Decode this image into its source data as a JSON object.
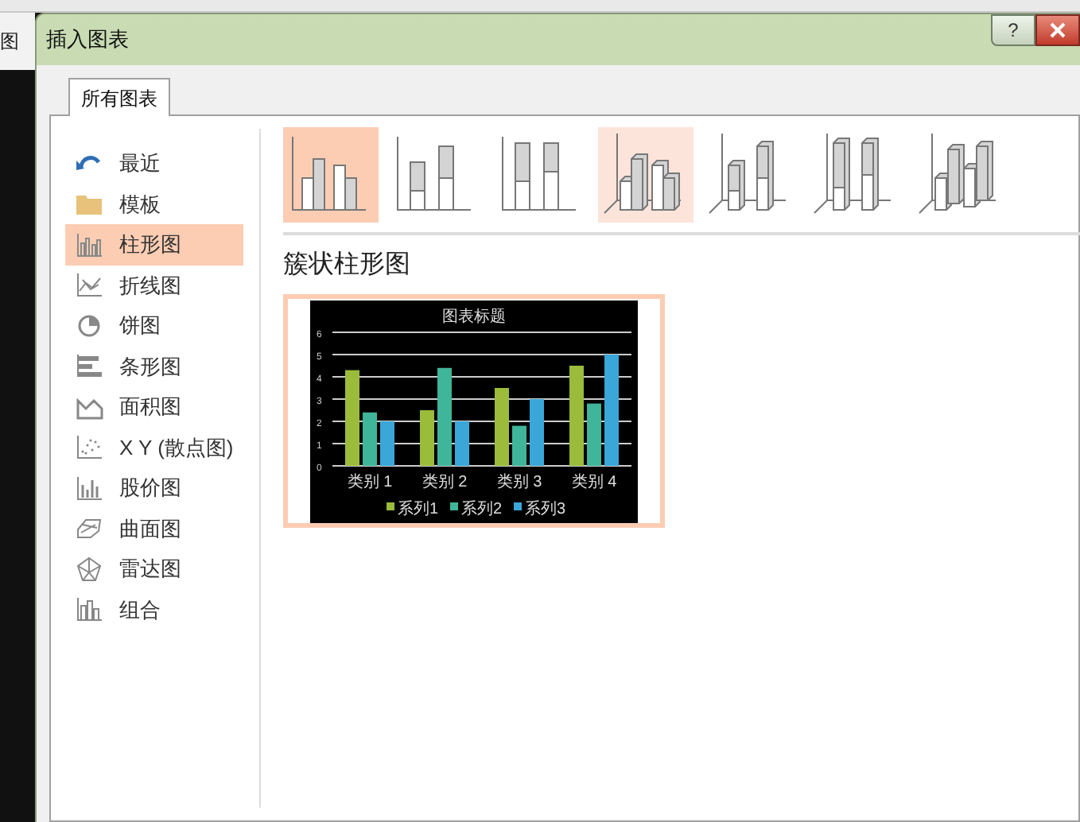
{
  "background": {
    "ribbon_label": "图"
  },
  "window": {
    "title": "插入图表",
    "help": "?"
  },
  "tabs": [
    {
      "label": "所有图表",
      "selected": true
    }
  ],
  "sidebar": {
    "items": [
      {
        "label": "最近",
        "selected": false
      },
      {
        "label": "模板",
        "selected": false
      },
      {
        "label": "柱形图",
        "selected": true
      },
      {
        "label": "折线图",
        "selected": false
      },
      {
        "label": "饼图",
        "selected": false
      },
      {
        "label": "条形图",
        "selected": false
      },
      {
        "label": "面积图",
        "selected": false
      },
      {
        "label": "X Y (散点图)",
        "selected": false
      },
      {
        "label": "股价图",
        "selected": false
      },
      {
        "label": "曲面图",
        "selected": false
      },
      {
        "label": "雷达图",
        "selected": false
      },
      {
        "label": "组合",
        "selected": false
      }
    ]
  },
  "subtypes": [
    {
      "kind": "clustered",
      "selected": true,
      "hovered": false
    },
    {
      "kind": "stacked",
      "selected": false,
      "hovered": false
    },
    {
      "kind": "percent",
      "selected": false,
      "hovered": false
    },
    {
      "kind": "clustered3d",
      "selected": false,
      "hovered": true
    },
    {
      "kind": "stacked3d",
      "selected": false,
      "hovered": false
    },
    {
      "kind": "percent3d",
      "selected": false,
      "hovered": false
    },
    {
      "kind": "column3d",
      "selected": false,
      "hovered": false
    }
  ],
  "heading": "簇状柱形图",
  "preview": {
    "chart_data": {
      "type": "bar",
      "title": "图表标题",
      "categories": [
        "类别 1",
        "类别 2",
        "类别 3",
        "类别 4"
      ],
      "series": [
        {
          "name": "系列1",
          "color": "#9bbb3b",
          "values": [
            4.3,
            2.5,
            3.5,
            4.5
          ]
        },
        {
          "name": "系列2",
          "color": "#3fb59a",
          "values": [
            2.4,
            4.4,
            1.8,
            2.8
          ]
        },
        {
          "name": "系列3",
          "color": "#3aa7d8",
          "values": [
            2,
            2,
            3,
            5
          ]
        }
      ],
      "ylim": [
        0,
        6
      ],
      "yticks": [
        0,
        1,
        2,
        3,
        4,
        5,
        6
      ],
      "grid": true,
      "legend": true
    }
  }
}
